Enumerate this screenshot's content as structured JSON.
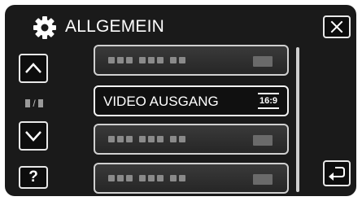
{
  "header": {
    "title": "ALLGEMEIN",
    "icon": "gear-icon"
  },
  "controls": {
    "close_icon": "close-icon",
    "up_icon": "chevron-up-icon",
    "down_icon": "chevron-down-icon",
    "help_label": "?",
    "back_icon": "back-arrow-icon",
    "page_indicator_separator": "/"
  },
  "menu": {
    "items": [
      {
        "label": "",
        "value": "",
        "state": "blurred"
      },
      {
        "label": "VIDEO AUSGANG",
        "value": "16:9",
        "state": "selected"
      },
      {
        "label": "",
        "value": "",
        "state": "blurred"
      },
      {
        "label": "",
        "value": "",
        "state": "blurred"
      }
    ]
  },
  "colors": {
    "background": "#1a1a1a",
    "text": "#ffffff",
    "border": "#e8e8e8"
  }
}
